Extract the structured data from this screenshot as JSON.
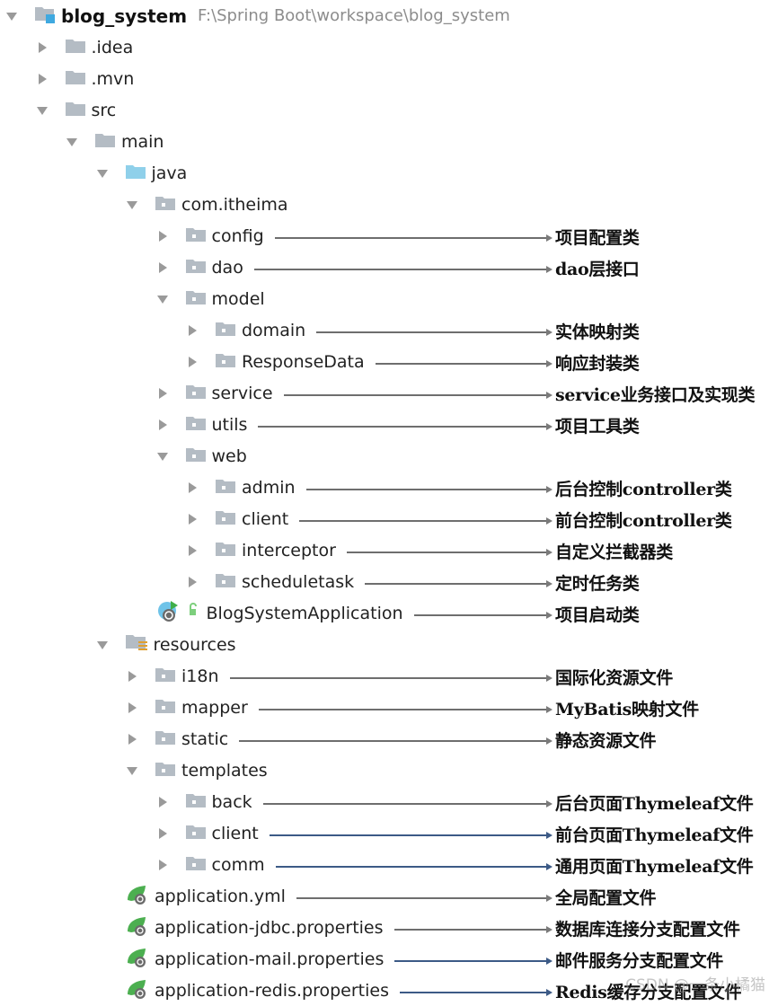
{
  "project": {
    "name": "blog_system",
    "path": "F:\\Spring Boot\\workspace\\blog_system"
  },
  "tree": [
    {
      "id": "root",
      "label": "blog_system",
      "depth": 0,
      "expanded": true,
      "icon": "project-folder-icon"
    },
    {
      "id": "idea",
      "label": ".idea",
      "depth": 1,
      "expanded": false,
      "icon": "folder-icon"
    },
    {
      "id": "mvn",
      "label": ".mvn",
      "depth": 1,
      "expanded": false,
      "icon": "folder-icon"
    },
    {
      "id": "src",
      "label": "src",
      "depth": 1,
      "expanded": true,
      "icon": "folder-icon"
    },
    {
      "id": "main",
      "label": "main",
      "depth": 2,
      "expanded": true,
      "icon": "folder-icon"
    },
    {
      "id": "java",
      "label": "java",
      "depth": 3,
      "expanded": true,
      "icon": "source-root-folder-icon"
    },
    {
      "id": "pkg",
      "label": "com.itheima",
      "depth": 4,
      "expanded": true,
      "icon": "package-icon"
    },
    {
      "id": "config",
      "label": "config",
      "depth": 5,
      "expanded": false,
      "icon": "package-icon",
      "note": "项目配置类"
    },
    {
      "id": "dao",
      "label": "dao",
      "depth": 5,
      "expanded": false,
      "icon": "package-icon",
      "note": "dao层接口"
    },
    {
      "id": "model",
      "label": "model",
      "depth": 5,
      "expanded": true,
      "icon": "package-icon"
    },
    {
      "id": "domain",
      "label": "domain",
      "depth": 6,
      "expanded": false,
      "icon": "package-icon",
      "note": "实体映射类"
    },
    {
      "id": "responsedata",
      "label": "ResponseData",
      "depth": 6,
      "expanded": false,
      "icon": "package-icon",
      "note": "响应封装类"
    },
    {
      "id": "service",
      "label": "service",
      "depth": 5,
      "expanded": false,
      "icon": "package-icon",
      "note": "service业务接口及实现类"
    },
    {
      "id": "utils",
      "label": "utils",
      "depth": 5,
      "expanded": false,
      "icon": "package-icon",
      "note": "项目工具类"
    },
    {
      "id": "web",
      "label": "web",
      "depth": 5,
      "expanded": true,
      "icon": "package-icon"
    },
    {
      "id": "admin",
      "label": "admin",
      "depth": 6,
      "expanded": false,
      "icon": "package-icon",
      "note": "后台控制controller类"
    },
    {
      "id": "client",
      "label": "client",
      "depth": 6,
      "expanded": false,
      "icon": "package-icon",
      "note": "前台控制controller类"
    },
    {
      "id": "interceptor",
      "label": "interceptor",
      "depth": 6,
      "expanded": false,
      "icon": "package-icon",
      "note": "自定义拦截器类"
    },
    {
      "id": "scheduletask",
      "label": "scheduletask",
      "depth": 6,
      "expanded": false,
      "icon": "package-icon",
      "note": "定时任务类"
    },
    {
      "id": "app",
      "label": "BlogSystemApplication",
      "depth": 5,
      "leaf": true,
      "icon": "spring-boot-app-icon",
      "note": "项目启动类"
    },
    {
      "id": "resources",
      "label": "resources",
      "depth": 3,
      "expanded": true,
      "icon": "resources-folder-icon"
    },
    {
      "id": "i18n",
      "label": "i18n",
      "depth": 4,
      "expanded": false,
      "icon": "package-icon",
      "note": "国际化资源文件"
    },
    {
      "id": "mapper",
      "label": "mapper",
      "depth": 4,
      "expanded": false,
      "icon": "package-icon",
      "note": "MyBatis映射文件"
    },
    {
      "id": "static",
      "label": "static",
      "depth": 4,
      "expanded": false,
      "icon": "package-icon",
      "note": "静态资源文件"
    },
    {
      "id": "templates",
      "label": "templates",
      "depth": 4,
      "expanded": true,
      "icon": "package-icon"
    },
    {
      "id": "back",
      "label": "back",
      "depth": 5,
      "expanded": false,
      "icon": "package-icon",
      "note": "后台页面Thymeleaf文件"
    },
    {
      "id": "tclient",
      "label": "client",
      "depth": 5,
      "expanded": false,
      "icon": "package-icon",
      "note": "前台页面Thymeleaf文件",
      "line": "blue"
    },
    {
      "id": "comm",
      "label": "comm",
      "depth": 5,
      "expanded": false,
      "icon": "package-icon",
      "note": "通用页面Thymeleaf文件",
      "line": "blue"
    },
    {
      "id": "appyml",
      "label": "application.yml",
      "depth": 4,
      "leaf": true,
      "icon": "spring-config-icon",
      "note": "全局配置文件"
    },
    {
      "id": "jdbc",
      "label": "application-jdbc.properties",
      "depth": 4,
      "leaf": true,
      "icon": "spring-config-icon",
      "note": "数据库连接分支配置文件"
    },
    {
      "id": "mail",
      "label": "application-mail.properties",
      "depth": 4,
      "leaf": true,
      "icon": "spring-config-icon",
      "note": "邮件服务分支配置文件",
      "line": "blue"
    },
    {
      "id": "redis",
      "label": "application-redis.properties",
      "depth": 4,
      "leaf": true,
      "icon": "spring-config-icon",
      "note": "Redis缓存分支配置文件",
      "line": "blue"
    }
  ],
  "colors": {
    "folder": "#b4bcc4",
    "source_root": "#8fd0ea",
    "project_badge": "#3fa9e0",
    "spring_green": "#4caf50",
    "arrow_gray": "#6e6e6e",
    "arrow_blue": "#3c5a86"
  },
  "watermark": "CSDN @一条小橘猫"
}
